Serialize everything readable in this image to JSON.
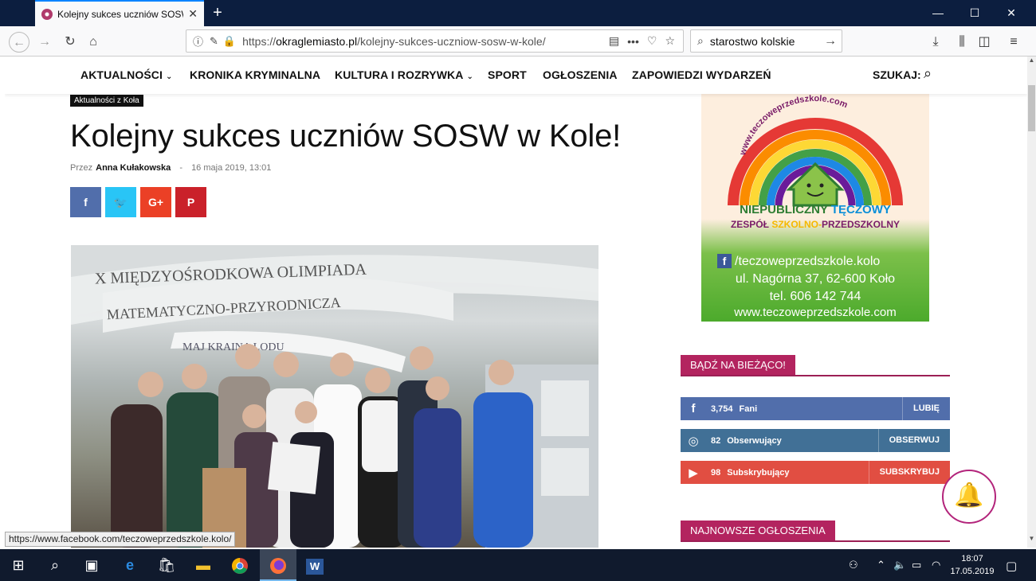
{
  "browser": {
    "tab_title": "Kolejny sukces uczniów SOSW w",
    "url_domain": "okraglemiasto.pl",
    "url_prefix": "https://",
    "url_path": "/kolejny-sukces-uczniow-sosw-w-kole/",
    "search_value": "starostwo kolskie",
    "status_url": "https://www.facebook.com/teczoweprzedszkole.kolo/"
  },
  "site_nav": {
    "items": [
      {
        "label": "AKTUALNOŚCI",
        "has_dropdown": true
      },
      {
        "label": "KRONIKA KRYMINALNA",
        "has_dropdown": false
      },
      {
        "label": "KULTURA I ROZRYWKA",
        "has_dropdown": true
      },
      {
        "label": "SPORT",
        "has_dropdown": false
      },
      {
        "label": "OGŁOSZENIA",
        "has_dropdown": false
      },
      {
        "label": "ZAPOWIEDZI WYDARZEŃ",
        "has_dropdown": false
      }
    ],
    "search_label": "SZUKAJ:"
  },
  "article": {
    "category": "Aktualności z Koła",
    "title": "Kolejny sukces uczniów SOSW w Kole!",
    "by_prefix": "Przez",
    "author": "Anna Kułakowska",
    "separator": "-",
    "date": "16 maja 2019, 13:01",
    "share_buttons": [
      {
        "icon": "facebook-icon",
        "glyph": "f",
        "color": "#516eab"
      },
      {
        "icon": "twitter-icon",
        "glyph": "🐦",
        "color": "#29c5f6"
      },
      {
        "icon": "google-plus-icon",
        "glyph": "G+",
        "color": "#eb4026"
      },
      {
        "icon": "pinterest-icon",
        "glyph": "P",
        "color": "#ca212a"
      }
    ],
    "photo_banner": [
      "X MIĘDZYOŚRODKOWA OLIMPIADA",
      "MATEMATYCZNO-PRZYRODNICZA",
      "MAJ     KRAINA LODU"
    ]
  },
  "ad": {
    "arc_text": "www.teczoweprzedszkole.com",
    "line1_a": "NIEPUBLICZNY",
    "line1_b": "TĘCZOWY",
    "line2_a": "ZESPÓŁ",
    "line2_b": "SZKOLNO-",
    "line2_c": "PRZEDSZKOLNY",
    "fb_glyph": "f",
    "fb": "/teczoweprzedszkole.kolo",
    "address": "ul. Nagórna 37, 62-600 Koło",
    "phone": "tel. 606 142 744",
    "site": "www.teczoweprzedszkole.com"
  },
  "sidebar": {
    "stay_updated": "BĄDŹ NA BIEŻĄCO!",
    "social": [
      {
        "name": "facebook",
        "icon": "facebook-icon",
        "glyph": "f",
        "count": "3,754",
        "label": "Fani",
        "action": "LUBIĘ",
        "color": "#516eab"
      },
      {
        "name": "instagram",
        "icon": "instagram-icon",
        "glyph": "◎",
        "count": "82",
        "label": "Obserwujący",
        "action": "OBSERWUJ",
        "color": "#417096"
      },
      {
        "name": "youtube",
        "icon": "youtube-icon",
        "glyph": "▶",
        "count": "98",
        "label": "Subskrybujący",
        "action": "SUBSKRYBUJ",
        "color": "#e14e42"
      }
    ],
    "newest_ads": "NAJNOWSZE OGŁOSZENIA"
  },
  "taskbar": {
    "time": "18:07",
    "date": "17.05.2019"
  },
  "colors": {
    "accent": "#b3245f",
    "firefox_tab_accent": "#0a84ff"
  }
}
